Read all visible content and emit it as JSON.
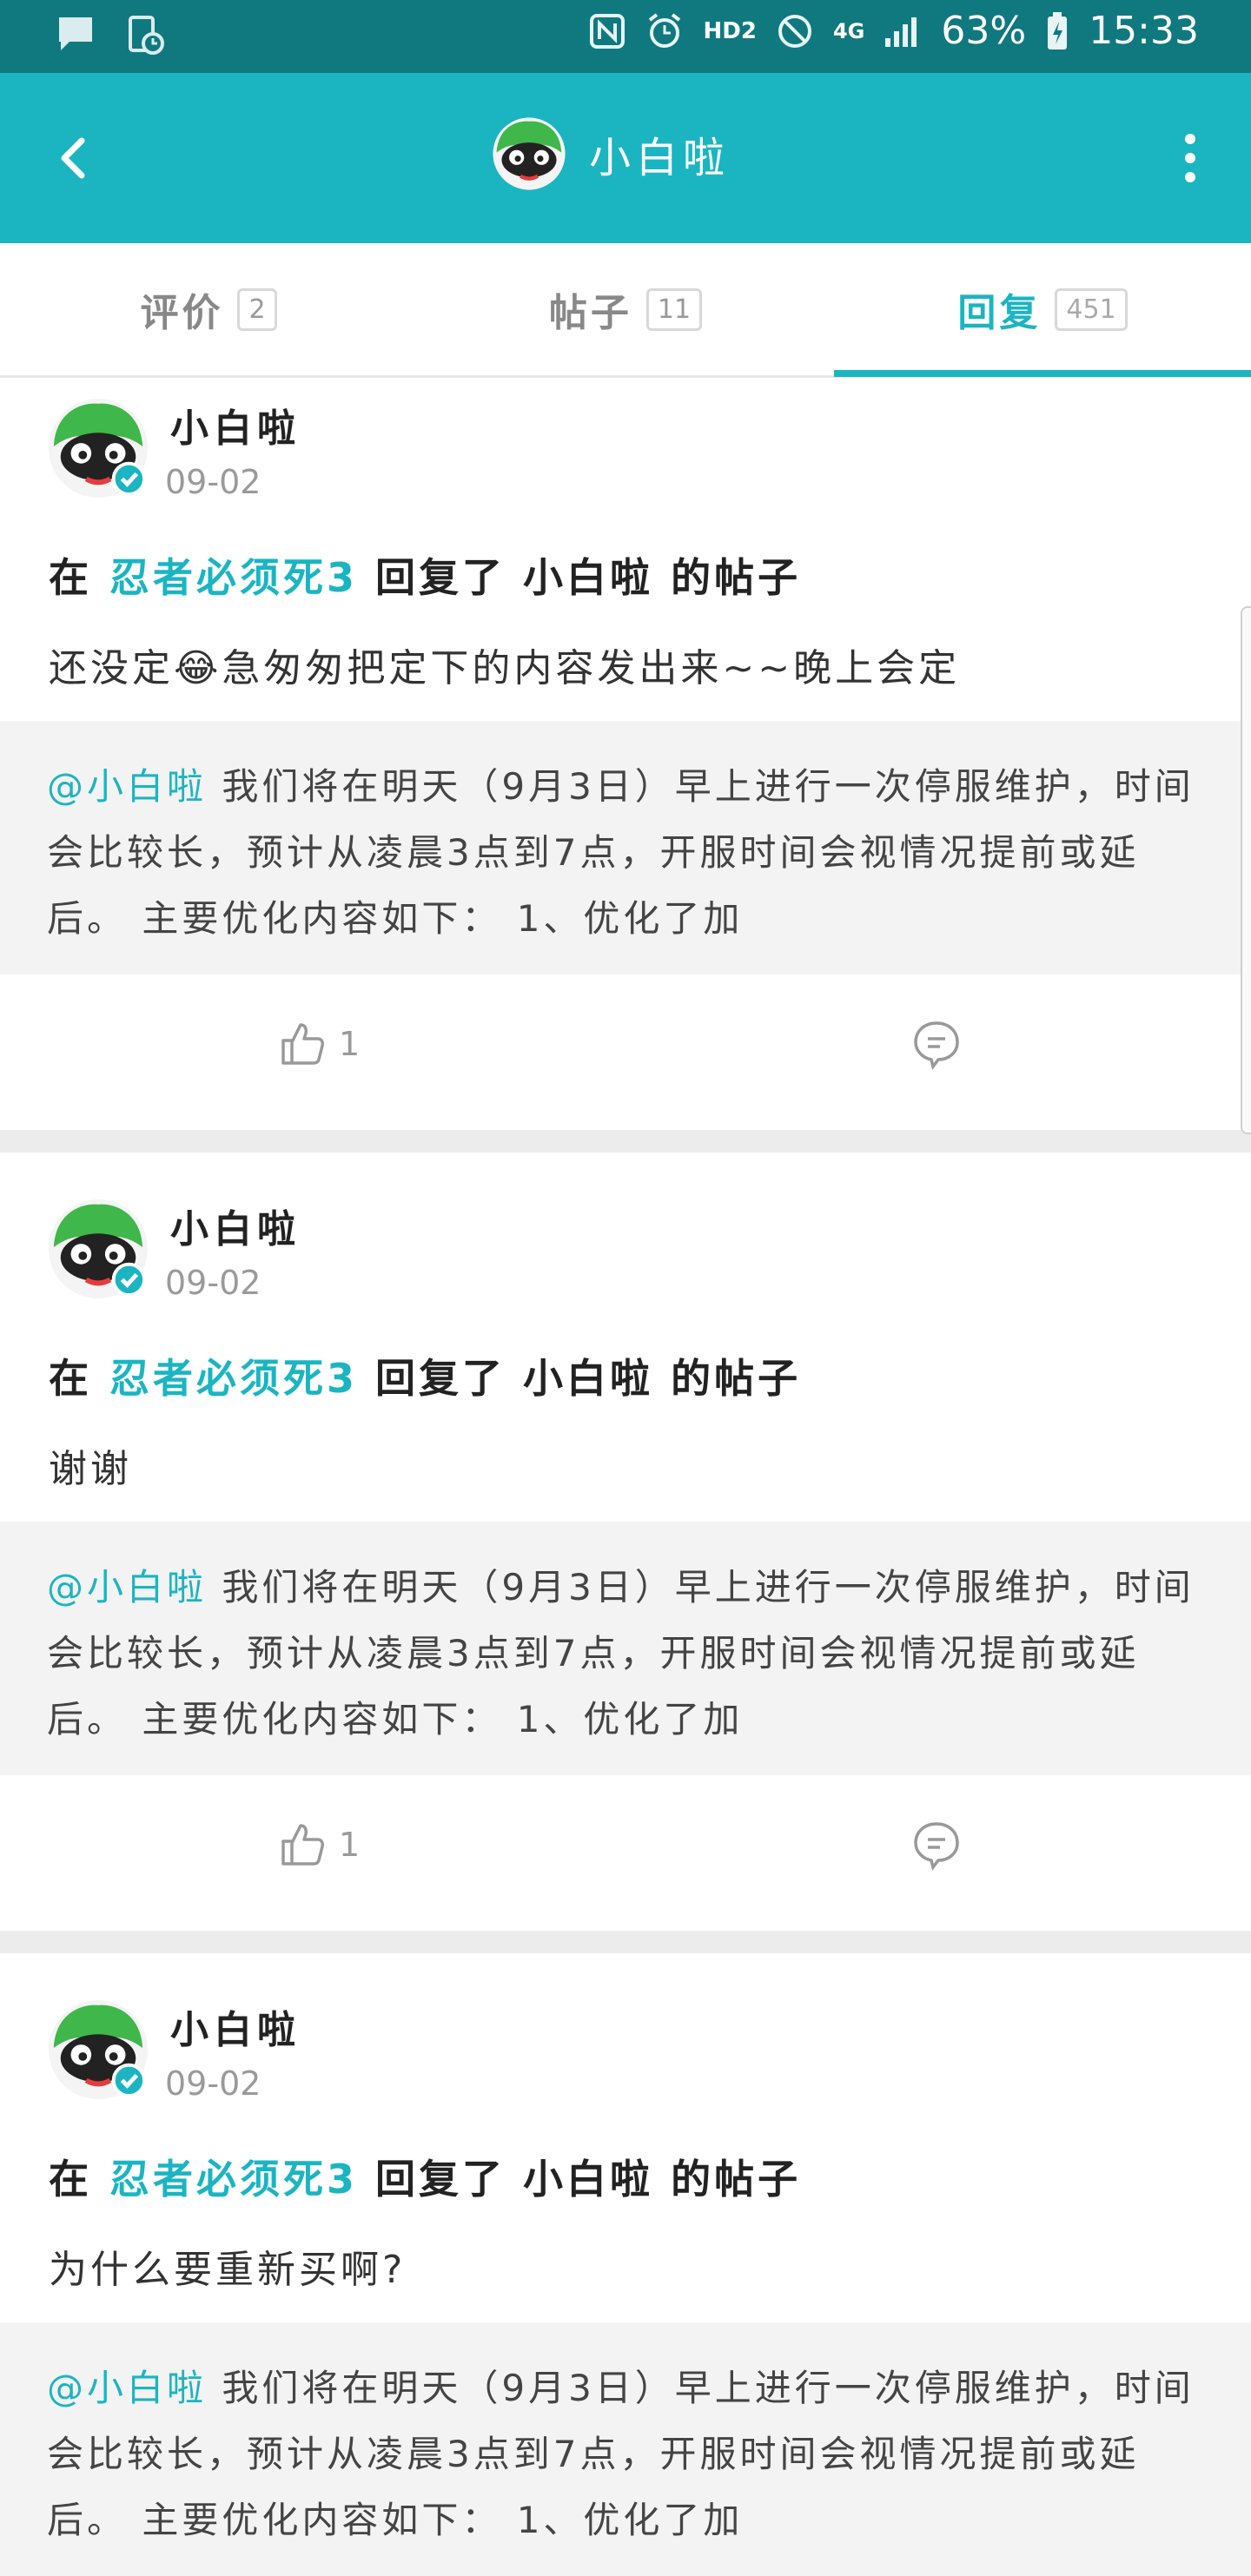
{
  "status_bar": {
    "battery": "63%",
    "time": "15:33",
    "network": "4G",
    "hd": "HD2"
  },
  "header": {
    "title": "小白啦"
  },
  "tabs": [
    {
      "label": "评价",
      "count": "2"
    },
    {
      "label": "帖子",
      "count": "11"
    },
    {
      "label": "回复",
      "count": "451",
      "active": true
    }
  ],
  "posts": [
    {
      "author": "小白啦",
      "date": "09-02",
      "prefix": "在",
      "game": "忍者必须死3",
      "suffix": "回复了 小白啦 的帖子",
      "content": "还没定😂急匆匆把定下的内容发出来~~晚上会定",
      "quote_mention": "@小白啦",
      "quote_text": " 我们将在明天（9月3日）早上进行一次停服维护，时间会比较长，预计从凌晨3点到7点，开服时间会视情况提前或延后。 主要优化内容如下： 1、优化了加",
      "likes": "1"
    },
    {
      "author": "小白啦",
      "date": "09-02",
      "prefix": "在",
      "game": "忍者必须死3",
      "suffix": "回复了 小白啦 的帖子",
      "content": "谢谢",
      "quote_mention": "@小白啦",
      "quote_text": " 我们将在明天（9月3日）早上进行一次停服维护，时间会比较长，预计从凌晨3点到7点，开服时间会视情况提前或延后。 主要优化内容如下： 1、优化了加",
      "likes": "1"
    },
    {
      "author": "小白啦",
      "date": "09-02",
      "prefix": "在",
      "game": "忍者必须死3",
      "suffix": "回复了 小白啦 的帖子",
      "content": "为什么要重新买啊?",
      "quote_mention": "@小白啦",
      "quote_text": " 我们将在明天（9月3日）早上进行一次停服维护，时间会比较长，预计从凌晨3点到7点，开服时间会视情况提前或延后。 主要优化内容如下： 1、优化了加"
    }
  ],
  "colors": {
    "accent": "#1bb5c1",
    "status_bar": "#10797f",
    "quote_bg": "#f3f3f3"
  }
}
